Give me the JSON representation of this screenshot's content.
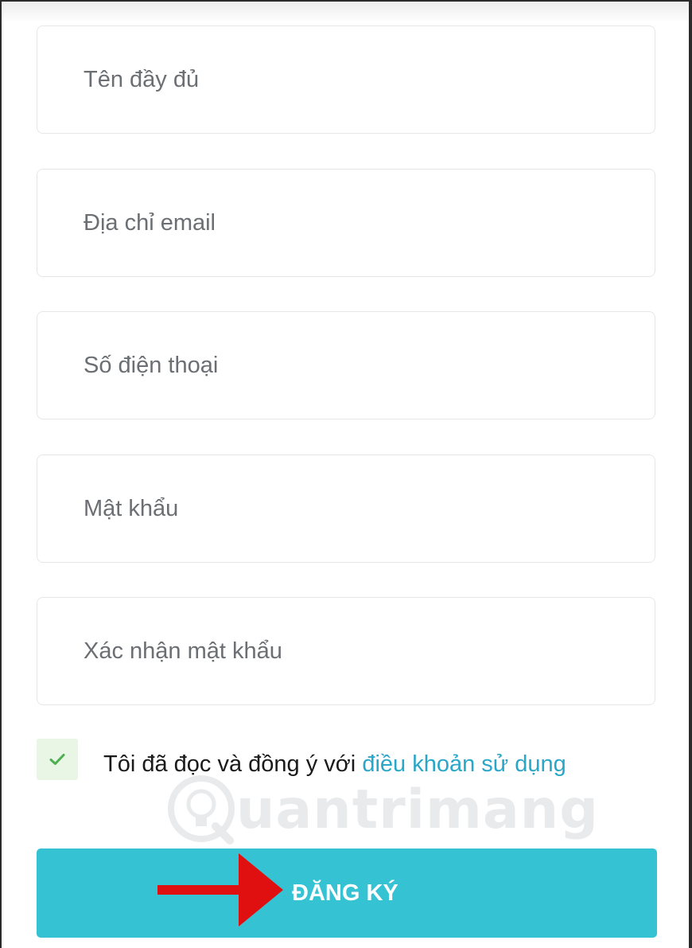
{
  "form": {
    "full_name_placeholder": "Tên đầy đủ",
    "email_placeholder": "Địa chỉ email",
    "phone_placeholder": "Số điện thoại",
    "password_placeholder": "Mật khẩu",
    "confirm_password_placeholder": "Xác nhận mật khẩu"
  },
  "terms": {
    "checked": true,
    "text": "Tôi đã đọc và đồng ý với ",
    "link_text": "điều khoản sử dụng"
  },
  "submit_label": "ĐĂNG KÝ",
  "watermark_text": "uantrimang",
  "icons": {
    "checkbox": "check-icon",
    "annotation": "red-arrow-icon",
    "watermark_logo": "lightbulb-icon"
  },
  "colors": {
    "accent": "#35c2d3",
    "link": "#2aa6c9",
    "checkbox_bg": "#e9f5e5",
    "check": "#4caf50",
    "arrow": "#e01010"
  }
}
